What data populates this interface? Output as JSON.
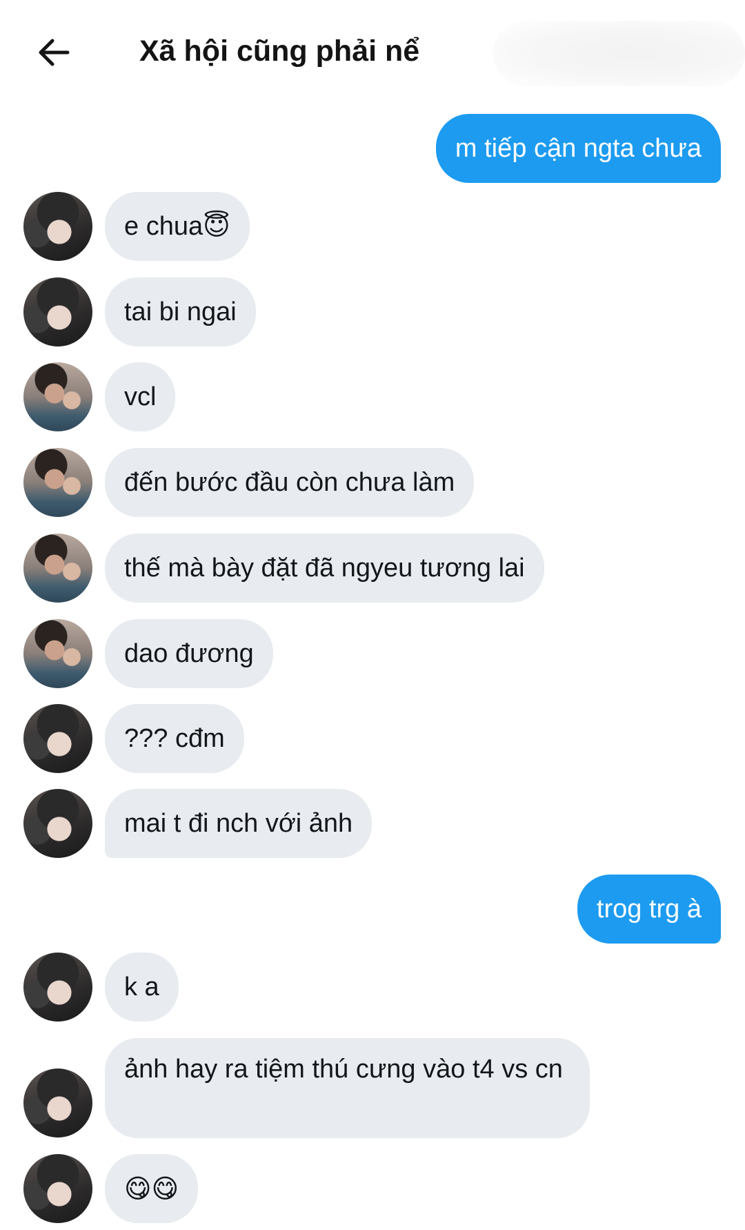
{
  "header": {
    "back_icon": "arrow-left-icon",
    "title": "Xã hội cũng phải nể"
  },
  "messages": [
    {
      "direction": "out",
      "text": "m tiếp cận ngta chưa"
    },
    {
      "direction": "in",
      "avatar": "avatar-dark-hair",
      "text": "e chua😇"
    },
    {
      "direction": "in",
      "avatar": "avatar-dark-hair",
      "text": "tai bi ngai"
    },
    {
      "direction": "in",
      "avatar": "avatar-peace-sign",
      "text": "vcl"
    },
    {
      "direction": "in",
      "avatar": "avatar-peace-sign",
      "text": "đến bước đầu còn chưa làm"
    },
    {
      "direction": "in",
      "avatar": "avatar-peace-sign",
      "text": "thế mà bày đặt đã ngyeu tương lai"
    },
    {
      "direction": "in",
      "avatar": "avatar-peace-sign",
      "text": "dao đương"
    },
    {
      "direction": "in",
      "avatar": "avatar-dark-hair",
      "text": "??? cđm"
    },
    {
      "direction": "in",
      "avatar": "avatar-dark-hair",
      "text": "mai t đi nch với ảnh"
    },
    {
      "direction": "out",
      "text": "trog trg à"
    },
    {
      "direction": "in",
      "avatar": "avatar-dark-hair",
      "text": "k a"
    },
    {
      "direction": "in",
      "avatar": "avatar-dark-hair",
      "text": "ảnh hay ra tiệm thú cưng vào t4 vs cn"
    },
    {
      "direction": "in",
      "avatar": "avatar-dark-hair",
      "text": "😋😋"
    }
  ],
  "colors": {
    "outgoing_bubble": "#1d9bf0",
    "incoming_bubble": "#e8ebef",
    "text_dark": "#14171a"
  }
}
